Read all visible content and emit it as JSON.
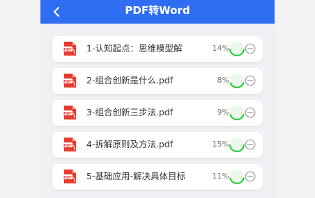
{
  "header": {
    "title": "PDF转Word",
    "back_icon": "chevron-left-icon"
  },
  "colors": {
    "header_bg": "#2f6df2",
    "pdf_red": "#e83a30",
    "progress_green": "#2ecc40"
  },
  "files": [
    {
      "name": "1-认知起点：思维模型解",
      "percent_label": "14%",
      "progress": 0.14
    },
    {
      "name": "2-组合创新是什么.pdf",
      "percent_label": "8%",
      "progress": 0.08
    },
    {
      "name": "3-组合创新三步法.pdf",
      "percent_label": "9%",
      "progress": 0.09
    },
    {
      "name": "4-拆解原则及方法.pdf",
      "percent_label": "15%",
      "progress": 0.15
    },
    {
      "name": "5-基础应用-解决具体目标",
      "percent_label": "11%",
      "progress": 0.11
    }
  ]
}
